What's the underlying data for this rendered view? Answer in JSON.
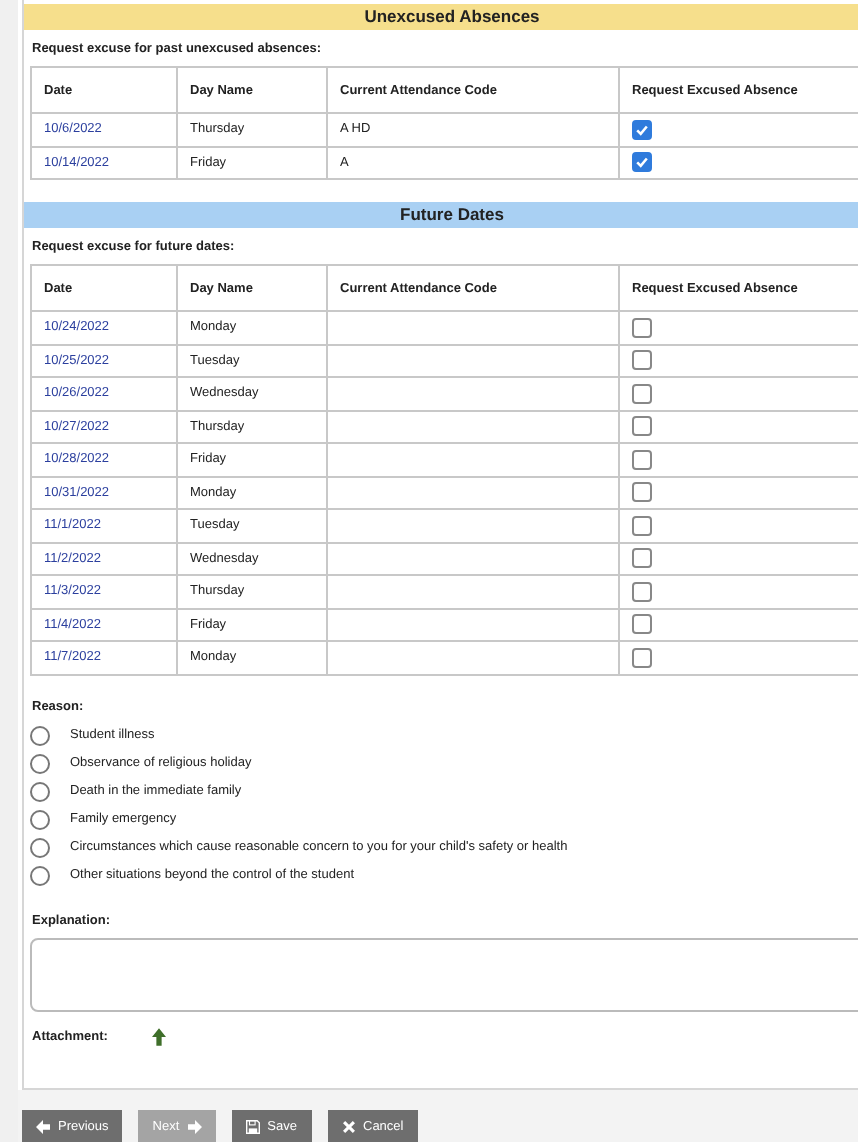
{
  "sections": [
    {
      "title": "Unexcused Absences",
      "color": "#f6df8c",
      "subtitle": "Request excuse for past unexcused absences:",
      "columns": [
        "Date",
        "Day Name",
        "Current Attendance Code",
        "Request Excused Absence"
      ],
      "rows": [
        {
          "date": "10/6/2022",
          "day": "Thursday",
          "code": "A HD",
          "checked": true
        },
        {
          "date": "10/14/2022",
          "day": "Friday",
          "code": "A",
          "checked": true
        }
      ]
    },
    {
      "title": "Future Dates",
      "color": "#a9d0f3",
      "subtitle": "Request excuse for future dates:",
      "columns": [
        "Date",
        "Day Name",
        "Current Attendance Code",
        "Request Excused Absence"
      ],
      "rows": [
        {
          "date": "10/24/2022",
          "day": "Monday",
          "checked": false
        },
        {
          "date": "10/25/2022",
          "day": "Tuesday",
          "checked": false
        },
        {
          "date": "10/26/2022",
          "day": "Wednesday",
          "checked": false
        },
        {
          "date": "10/27/2022",
          "day": "Thursday",
          "checked": false
        },
        {
          "date": "10/28/2022",
          "day": "Friday",
          "checked": false
        },
        {
          "date": "10/31/2022",
          "day": "Monday",
          "checked": false
        },
        {
          "date": "11/1/2022",
          "day": "Tuesday",
          "checked": false
        },
        {
          "date": "11/2/2022",
          "day": "Wednesday",
          "checked": false
        },
        {
          "date": "11/3/2022",
          "day": "Thursday",
          "checked": false
        },
        {
          "date": "11/4/2022",
          "day": "Friday",
          "checked": false
        },
        {
          "date": "11/7/2022",
          "day": "Monday",
          "checked": false
        }
      ]
    }
  ],
  "reason": {
    "label": "Reason:",
    "options": [
      {
        "label": "Student illness",
        "selected": false
      },
      {
        "label": "Observance of religious holiday",
        "selected": false
      },
      {
        "label": "Death in the immediate family",
        "selected": false
      },
      {
        "label": "Family emergency",
        "selected": false
      },
      {
        "label": "Circumstances which cause reasonable concern to you for your child's safety or health",
        "selected": false
      },
      {
        "label": "Other situations beyond the control of the student",
        "selected": false
      }
    ]
  },
  "explanation": {
    "label": "Explanation:"
  },
  "attachment": {
    "label": "Attachment:"
  },
  "buttons": [
    {
      "label": "Previous",
      "kind": "previous",
      "disabled": false
    },
    {
      "label": "Next",
      "kind": "next",
      "disabled": true
    },
    {
      "label": "Save",
      "kind": "save",
      "disabled": false
    },
    {
      "label": "Cancel",
      "kind": "cancel",
      "disabled": false
    }
  ]
}
